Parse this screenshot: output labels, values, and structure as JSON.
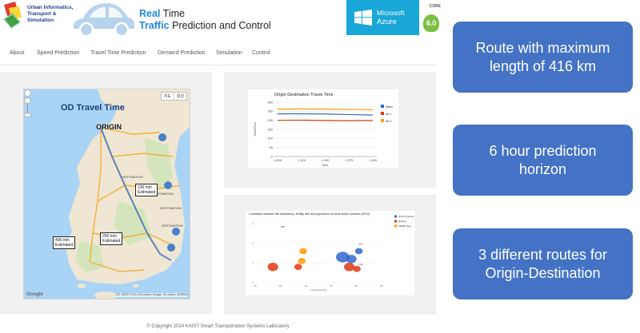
{
  "header": {
    "lab_name": [
      "Urban Informatics,",
      "Transport &",
      "Simulation"
    ],
    "title_line1": {
      "highlight": "Real",
      "rest": " Time"
    },
    "title_line2": {
      "highlight": "Traffic",
      "rest": " Prediction and Control"
    },
    "azure": {
      "brand": "Microsoft",
      "product": "Azure",
      "color": "#19a7d8"
    },
    "core_logo": {
      "text": "CORE",
      "badge": "6.0"
    }
  },
  "nav": {
    "items": [
      {
        "label": "About"
      },
      {
        "label": "Speed Prediction"
      },
      {
        "label": "Travel Time Prediction"
      },
      {
        "label": "Demand Prediction"
      },
      {
        "label": "Simulation"
      },
      {
        "label": "Control"
      }
    ]
  },
  "map": {
    "title": "OD Travel Time",
    "origin_label": "ORIGIN",
    "toggle": [
      "지도",
      "위성"
    ],
    "destination_label": "DESTINATION",
    "estimates": [
      {
        "time": "130 min",
        "label": "Estimated"
      },
      {
        "time": "250 min",
        "label": "Estimated"
      },
      {
        "time": "400 min",
        "label": "Estimated"
      }
    ],
    "google": "Google",
    "attribution": "지도 데이터 ©2014 SK planet, Google, SK planet, ZENRIN"
  },
  "line_chart": {
    "title": "Origin Destination Travel Time",
    "chart_data": {
      "type": "line",
      "x": [
        1000,
        1125,
        1250,
        1375,
        1500
      ],
      "xlabel": "Time",
      "ylabel": "TravelTime",
      "ylim": [
        0,
        300
      ],
      "yticks": [
        0,
        50,
        100,
        150,
        200,
        250,
        300
      ],
      "xtick_labels": [
        "1,000",
        "1,125",
        "1,250",
        "1,375",
        "1,500"
      ],
      "legend_position": "right",
      "series": [
        {
          "name": "Main",
          "color": "#3366cc",
          "values": [
            236,
            236,
            235,
            232,
            229
          ]
        },
        {
          "name": "alt 1",
          "color": "#dc3912",
          "values": [
            200,
            201,
            199,
            198,
            199
          ]
        },
        {
          "name": "alt 2",
          "color": "#ff9900",
          "values": [
            262,
            263,
            262,
            260,
            259
          ]
        }
      ]
    }
  },
  "bubble_chart": {
    "title": "Correlation between life expectancy, fertility rate and population of some world countries (2010)",
    "chart_data": {
      "type": "scatter",
      "xlabel": "Life Expectancy",
      "xlim": [
        60,
        85
      ],
      "xticks": [
        60,
        65,
        70,
        75,
        80,
        85
      ],
      "ylim": [
        0,
        3
      ],
      "yticks": [
        0,
        1,
        2,
        3
      ],
      "legend_position": "right",
      "series": [
        {
          "name": "North America",
          "color": "#3366cc",
          "points": [
            {
              "x": 77.3,
              "y": 1.3,
              "size": 3
            },
            {
              "x": 79.0,
              "y": 1.2,
              "size": 2
            },
            {
              "x": 80.5,
              "y": 1.6,
              "size": 1
            }
          ]
        },
        {
          "name": "Europe",
          "color": "#dc3912",
          "points": [
            {
              "x": 63.5,
              "y": 0.8,
              "size": 2
            },
            {
              "x": 68.5,
              "y": 0.8,
              "size": 1
            },
            {
              "x": 78.6,
              "y": 0.8,
              "size": 2
            },
            {
              "x": 80.1,
              "y": 0.7,
              "size": 1
            }
          ]
        },
        {
          "name": "Middle East",
          "color": "#ff9900",
          "points": [
            {
              "x": 69.2,
              "y": 1.1,
              "size": 1
            },
            {
              "x": 69.5,
              "y": 1.6,
              "size": 1
            }
          ]
        }
      ],
      "point_labels": [
        {
          "text": "GBR",
          "x": 65.0,
          "y": 2.8
        },
        {
          "text": "RUS",
          "x": 80.5,
          "y": 1.9
        },
        {
          "text": "DEU",
          "x": 80.5,
          "y": 0.9
        }
      ]
    }
  },
  "info_cards": [
    {
      "lines": [
        "Route with maximum",
        "length of 416 km"
      ]
    },
    {
      "lines": [
        "6 hour prediction",
        "horizon"
      ]
    },
    {
      "lines": [
        "3 different routes for",
        "Origin-Destination"
      ]
    }
  ],
  "footer": "© Copyright 2014 KAIST Smart Transportation Systems Laboratory"
}
